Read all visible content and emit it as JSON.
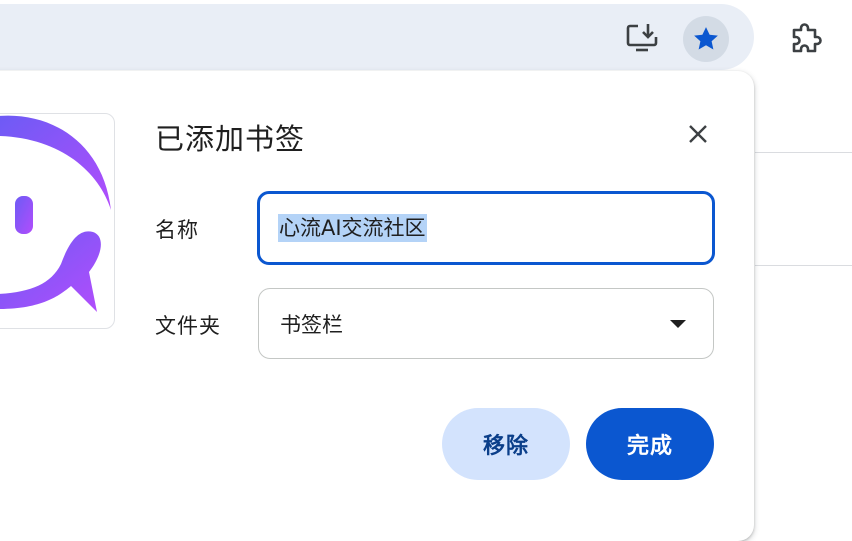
{
  "toolbar": {
    "install_icon": "install-app-icon",
    "bookmark_icon": "star-filled-icon",
    "extensions_icon": "puzzle-piece-icon"
  },
  "dialog": {
    "title": "已添加书签",
    "name_label": "名称",
    "name_value": "心流AI交流社区",
    "folder_label": "文件夹",
    "folder_value": "书签栏",
    "remove_label": "移除",
    "done_label": "完成"
  },
  "colors": {
    "accent": "#0b57d0",
    "remove_bg": "#d3e3fd",
    "selection": "#b4d3f7",
    "logo_purple": "#8a4dff"
  }
}
